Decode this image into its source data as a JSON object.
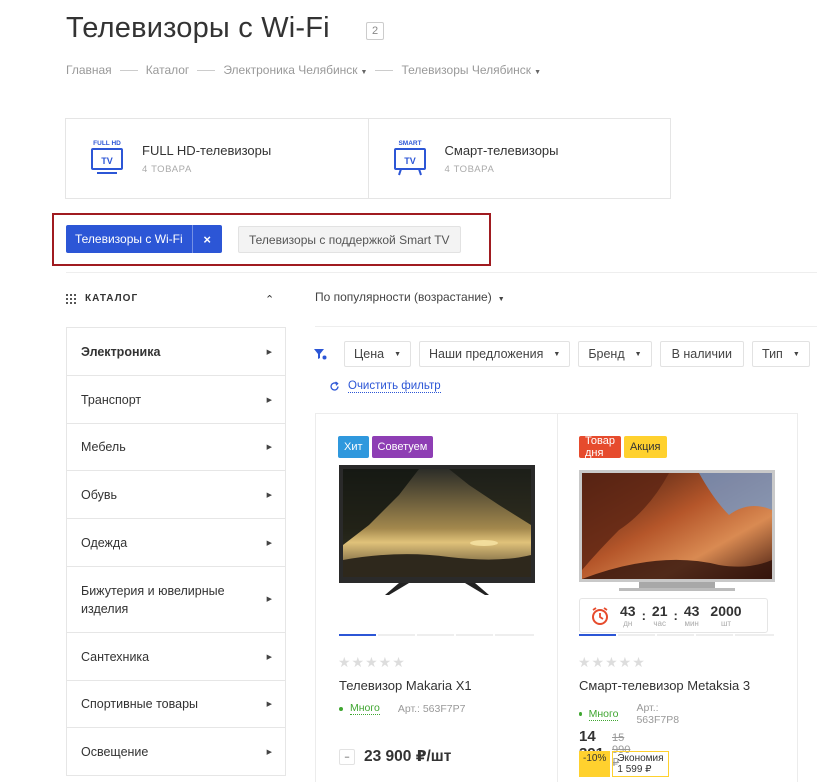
{
  "page": {
    "title": "Телевизоры с Wi-Fi",
    "count": "2"
  },
  "breadcrumb": [
    "Главная",
    "Каталог",
    "Электроника Челябинск",
    "Телевизоры Челябинск"
  ],
  "categories": [
    {
      "icon_text": "FULL HD",
      "name": "FULL HD-телевизоры",
      "count": "4 ТОВАРА"
    },
    {
      "icon_text": "SMART",
      "name": "Смарт-телевизоры",
      "count": "4 ТОВАРА"
    }
  ],
  "tags": {
    "active": "Телевизоры с Wi-Fi",
    "remove_icon": "×",
    "other": "Телевизоры с поддержкой Smart TV"
  },
  "catalog": {
    "heading": "КАТАЛОГ",
    "items": [
      "Электроника",
      "Транспорт",
      "Мебель",
      "Обувь",
      "Одежда",
      "Бижутерия и ювелирные изделия",
      "Сантехника",
      "Спортивные товары",
      "Освещение"
    ]
  },
  "sort": {
    "label": "По популярности (возрастание)"
  },
  "filters": [
    "Цена",
    "Наши предложения",
    "Бренд",
    "В наличии",
    "Тип"
  ],
  "clear_filter": "Очистить фильтр",
  "products": [
    {
      "badges": [
        "Хит",
        "Советуем"
      ],
      "name": "Телевизор Makaria X1",
      "stock": "Много",
      "article": "Арт.: 563F7P7",
      "price": "23 900 ₽/шт",
      "minus": "−"
    },
    {
      "badges": [
        "Товар дня",
        "Акция"
      ],
      "name": "Смарт-телевизор Metaksia 3",
      "stock": "Много",
      "article": "Арт.: 563F7P8",
      "price": "14 391 ₽/шт",
      "old_price": "15 990 ₽",
      "discount": "-10%",
      "economy": "Экономия 1 599 ₽",
      "timer": {
        "days": "43",
        "days_label": "дн",
        "hours": "21",
        "hours_label": "час",
        "minutes": "43",
        "minutes_label": "мин",
        "qty": "2000",
        "qty_label": "шт"
      }
    }
  ],
  "colors": {
    "accent": "#2c56d6",
    "highlight_border": "#a01b20",
    "badge_hit": "#2f98dd",
    "badge_recommend": "#8e3eb4",
    "badge_day": "#e64b2d",
    "badge_sale": "#ffd12e",
    "stock_green": "#3fa630"
  }
}
